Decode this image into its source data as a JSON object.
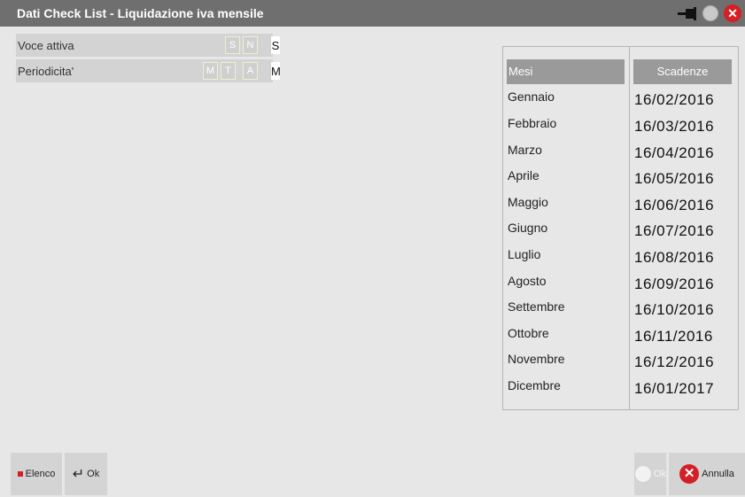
{
  "window": {
    "title": "Dati Check List - Liquidazione iva mensile"
  },
  "fields": {
    "voce_attiva": {
      "label": "Voce attiva",
      "options": [
        "S",
        "N"
      ],
      "value": "S"
    },
    "periodicita": {
      "label": "Periodicita'",
      "options": [
        "M",
        "T",
        "A"
      ],
      "value": "M"
    }
  },
  "table": {
    "headers": {
      "mesi": "Mesi",
      "scadenze": "Scadenze"
    },
    "rows": [
      {
        "mese": "Gennaio",
        "scadenza": "16/02/2016"
      },
      {
        "mese": "Febbraio",
        "scadenza": "16/03/2016"
      },
      {
        "mese": "Marzo",
        "scadenza": "16/04/2016"
      },
      {
        "mese": "Aprile",
        "scadenza": "16/05/2016"
      },
      {
        "mese": "Maggio",
        "scadenza": "16/06/2016"
      },
      {
        "mese": "Giugno",
        "scadenza": "16/07/2016"
      },
      {
        "mese": "Luglio",
        "scadenza": "16/08/2016"
      },
      {
        "mese": "Agosto",
        "scadenza": "16/09/2016"
      },
      {
        "mese": "Settembre",
        "scadenza": "16/10/2016"
      },
      {
        "mese": "Ottobre",
        "scadenza": "16/11/2016"
      },
      {
        "mese": "Novembre",
        "scadenza": "16/12/2016"
      },
      {
        "mese": "Dicembre",
        "scadenza": "16/01/2017"
      }
    ]
  },
  "footer": {
    "elenco_label": "Elenco",
    "ok_label": "Ok",
    "ok_disabled_label": "Ok",
    "annulla_label": "Annulla"
  },
  "colors": {
    "titlebar": "#6f6f6f",
    "accent_red": "#d51f26",
    "header_bg": "#9a9a9a"
  },
  "icons": [
    "pin-icon",
    "status-dot-icon",
    "close-icon",
    "enter-icon",
    "ok-check-icon",
    "cancel-icon"
  ]
}
